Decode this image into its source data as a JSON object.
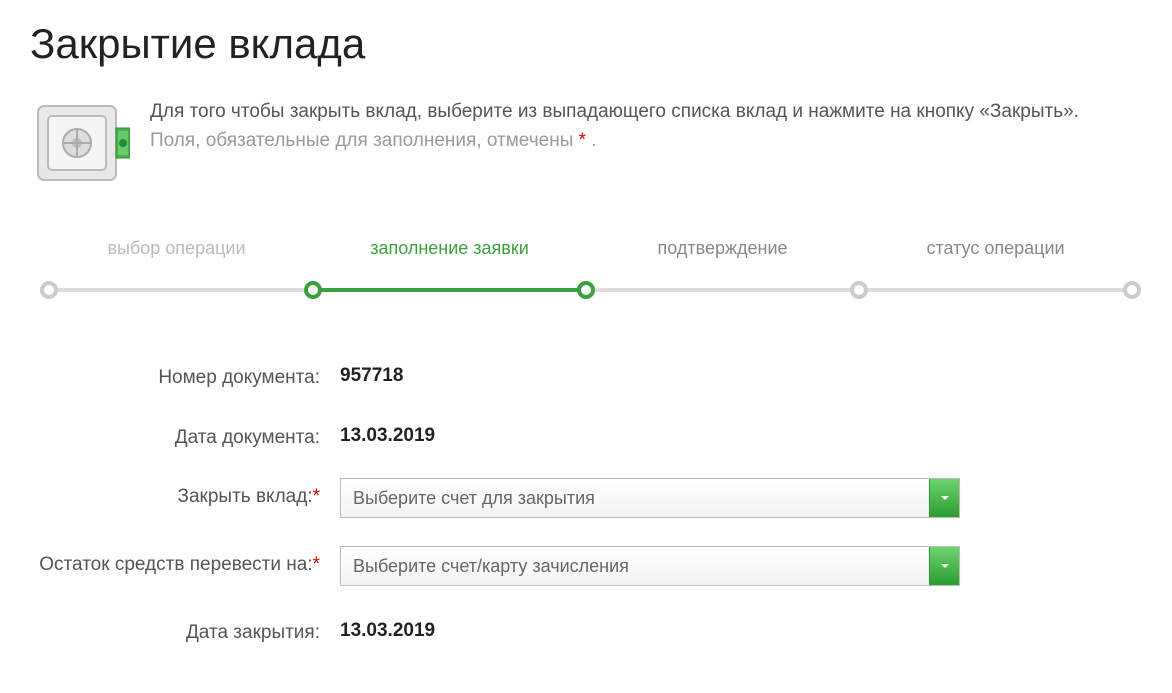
{
  "title": "Закрытие вклада",
  "intro": {
    "main": "Для того чтобы закрыть вклад, выберите из выпадающего списка вклад и нажмите на кнопку «Закрыть».",
    "hint": "Поля, обязательные для заполнения, отмечены ",
    "hint_end": " ."
  },
  "steps": [
    {
      "label": "выбор операции",
      "state": "done"
    },
    {
      "label": "заполнение заявки",
      "state": "active"
    },
    {
      "label": "подтверждение",
      "state": "upcoming"
    },
    {
      "label": "статус операции",
      "state": "upcoming"
    }
  ],
  "form": {
    "doc_number_label": "Номер документа:",
    "doc_number_value": "957718",
    "doc_date_label": "Дата документа:",
    "doc_date_value": "13.03.2019",
    "close_account_label": "Закрыть вклад:",
    "close_account_placeholder": "Выберите счет для закрытия",
    "transfer_to_label": "Остаток средств перевести на:",
    "transfer_to_placeholder": "Выберите счет/карту зачисления",
    "close_date_label": "Дата закрытия:",
    "close_date_value": "13.03.2019"
  }
}
